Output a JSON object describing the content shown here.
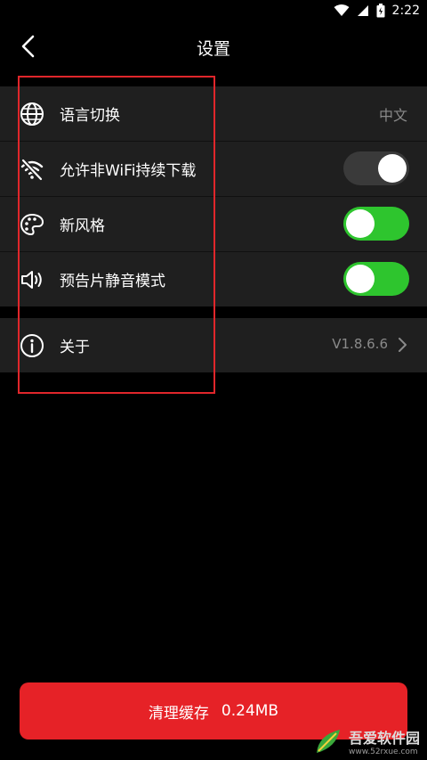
{
  "status_bar": {
    "time": "2:22"
  },
  "header": {
    "title": "设置"
  },
  "settings": [
    {
      "label": "语言切换",
      "value": "中文"
    },
    {
      "label": "允许非WiFi持续下载",
      "toggle_on": false
    },
    {
      "label": "新风格",
      "toggle_on": true
    },
    {
      "label": "预告片静音模式",
      "toggle_on": true
    }
  ],
  "about": {
    "label": "关于",
    "version": "V1.8.6.6"
  },
  "clear_cache": {
    "label": "清理缓存",
    "size": "0.24MB"
  },
  "watermark": {
    "title": "吾爱软件园",
    "url": "www.52rxue.com"
  },
  "colors": {
    "accent_red": "#e62227",
    "toggle_on": "#2ec52e",
    "highlight_border": "#e0262b"
  }
}
